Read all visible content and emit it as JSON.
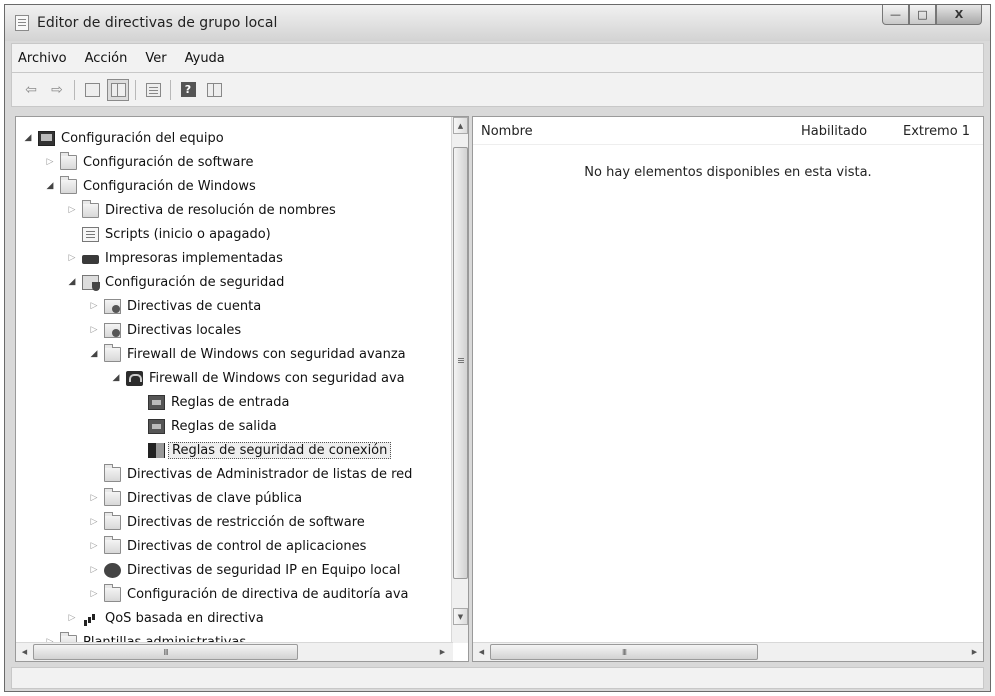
{
  "window": {
    "title": "Editor de directivas de grupo local",
    "controls": {
      "minimize": "—",
      "maximize": "□",
      "close": "X"
    }
  },
  "menu": {
    "items": [
      "Archivo",
      "Acción",
      "Ver",
      "Ayuda"
    ]
  },
  "toolbar": {
    "back_icon": "arrow-left-icon",
    "forward_icon": "arrow-right-icon",
    "help_label": "?"
  },
  "tree": {
    "nodes": [
      {
        "label": "Configuración del equipo",
        "state": "expanded",
        "icon": "computer-icon"
      },
      {
        "label": "Configuración de software",
        "state": "collapsed",
        "icon": "folder-icon"
      },
      {
        "label": "Configuración de Windows",
        "state": "expanded",
        "icon": "folder-icon"
      },
      {
        "label": "Directiva de resolución de nombres",
        "state": "collapsed",
        "icon": "folder-icon"
      },
      {
        "label": "Scripts (inicio o apagado)",
        "state": "none",
        "icon": "script-icon"
      },
      {
        "label": "Impresoras implementadas",
        "state": "collapsed",
        "icon": "printer-icon"
      },
      {
        "label": "Configuración de seguridad",
        "state": "expanded",
        "icon": "shield-doc-icon"
      },
      {
        "label": "Directivas de cuenta",
        "state": "collapsed",
        "icon": "policy-folder-icon"
      },
      {
        "label": "Directivas locales",
        "state": "collapsed",
        "icon": "policy-folder-icon"
      },
      {
        "label": "Firewall de Windows con seguridad avanza",
        "state": "expanded",
        "icon": "folder-icon"
      },
      {
        "label": "Firewall de Windows con seguridad ava",
        "state": "expanded",
        "icon": "firewall-icon"
      },
      {
        "label": "Reglas de entrada",
        "state": "none",
        "icon": "rule-icon"
      },
      {
        "label": "Reglas de salida",
        "state": "none",
        "icon": "rule-icon"
      },
      {
        "label": "Reglas de seguridad de conexión",
        "state": "none",
        "icon": "conn-icon",
        "selected": true
      },
      {
        "label": "Directivas de Administrador de listas de red",
        "state": "none",
        "icon": "folder-icon"
      },
      {
        "label": "Directivas de clave pública",
        "state": "collapsed",
        "icon": "folder-icon"
      },
      {
        "label": "Directivas de restricción de software",
        "state": "collapsed",
        "icon": "folder-icon"
      },
      {
        "label": "Directivas de control de aplicaciones",
        "state": "collapsed",
        "icon": "folder-icon"
      },
      {
        "label": "Directivas de seguridad IP en Equipo local",
        "state": "collapsed",
        "icon": "ipsec-icon"
      },
      {
        "label": "Configuración de directiva de auditoría ava",
        "state": "collapsed",
        "icon": "folder-icon"
      },
      {
        "label": "QoS basada en directiva",
        "state": "collapsed",
        "icon": "qos-icon"
      },
      {
        "label": "Plantillas administrativas",
        "state": "collapsed",
        "icon": "folder-icon"
      }
    ]
  },
  "list": {
    "columns": [
      "Nombre",
      "Habilitado",
      "Extremo 1"
    ],
    "empty_message": "No hay elementos disponibles en esta vista."
  },
  "scrollbars": {
    "thumb_grip": "III"
  }
}
